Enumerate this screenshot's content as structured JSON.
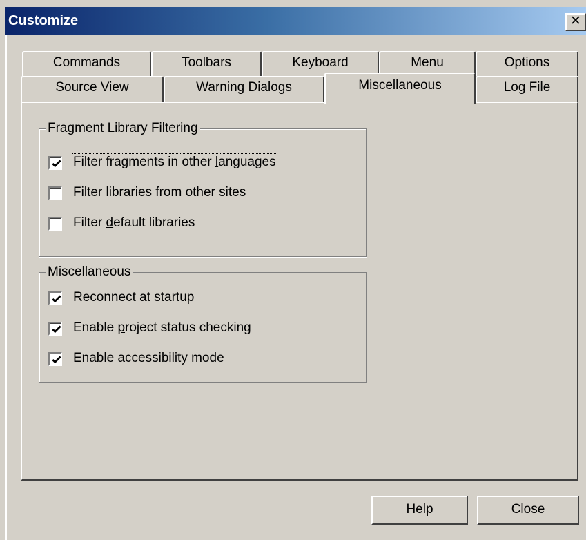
{
  "window": {
    "title": "Customize",
    "close_glyph": "✕"
  },
  "tabs": {
    "back_row": [
      {
        "label": "Commands"
      },
      {
        "label": "Toolbars"
      },
      {
        "label": "Keyboard"
      },
      {
        "label": "Menu"
      },
      {
        "label": "Options"
      }
    ],
    "front_row": [
      {
        "label": "Source View"
      },
      {
        "label": "Warning Dialogs"
      },
      {
        "label": "Miscellaneous",
        "selected": true
      },
      {
        "label": "Log File"
      }
    ]
  },
  "fragment_group": {
    "title": "Fragment Library Filtering",
    "items": [
      {
        "pre": "Filter fragments in other ",
        "mnemonic": "l",
        "post": "anguages",
        "checked": true
      },
      {
        "pre": "Filter libraries from other ",
        "mnemonic": "s",
        "post": "ites",
        "checked": false
      },
      {
        "pre": "Filter ",
        "mnemonic": "d",
        "post": "efault libraries",
        "checked": false
      }
    ]
  },
  "misc_group": {
    "title": "Miscellaneous",
    "items": [
      {
        "pre": "",
        "mnemonic": "R",
        "post": "econnect at startup",
        "checked": true
      },
      {
        "pre": "Enable ",
        "mnemonic": "p",
        "post": "roject status checking",
        "checked": true
      },
      {
        "pre": "Enable ",
        "mnemonic": "a",
        "post": "ccessibility mode",
        "checked": true
      }
    ]
  },
  "buttons": {
    "help": "Help",
    "close": "Close"
  },
  "icons": {
    "checkmark": "checkmark-icon",
    "close": "close-icon"
  }
}
